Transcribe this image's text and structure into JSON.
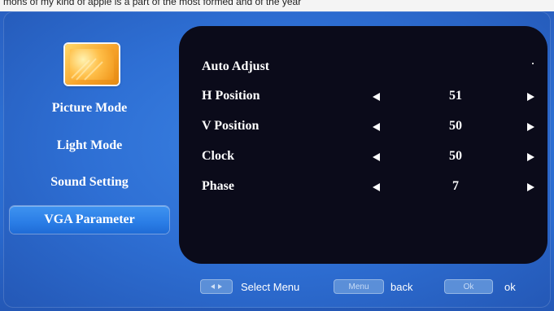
{
  "top_strip": {
    "text": "mons of my kind of apple is a part of the most formed and of the year"
  },
  "sidebar": {
    "items": [
      {
        "label": "Picture Mode"
      },
      {
        "label": "Light Mode"
      },
      {
        "label": "Sound Setting"
      },
      {
        "label": "VGA Parameter",
        "active": true
      }
    ]
  },
  "panel": {
    "title_row": {
      "label": "Auto Adjust"
    },
    "rows": [
      {
        "label": "H Position",
        "value": "51"
      },
      {
        "label": "V Position",
        "value": "50"
      },
      {
        "label": "Clock",
        "value": "50"
      },
      {
        "label": "Phase",
        "value": "7"
      }
    ]
  },
  "footer": {
    "select": {
      "button_text": "",
      "label": "Select Menu"
    },
    "back": {
      "button_text": "Menu",
      "label": "back"
    },
    "ok": {
      "button_text": "Ok",
      "label": "ok"
    }
  },
  "icons": {
    "logo": "picture-settings-icon",
    "left_arrow": "arrow-left-icon",
    "right_arrow": "arrow-right-icon"
  },
  "colors": {
    "background": "#2c6fd2",
    "panel": "#0b0b1a",
    "active_item": "#2a7de6",
    "logo": "#f7a32a"
  }
}
